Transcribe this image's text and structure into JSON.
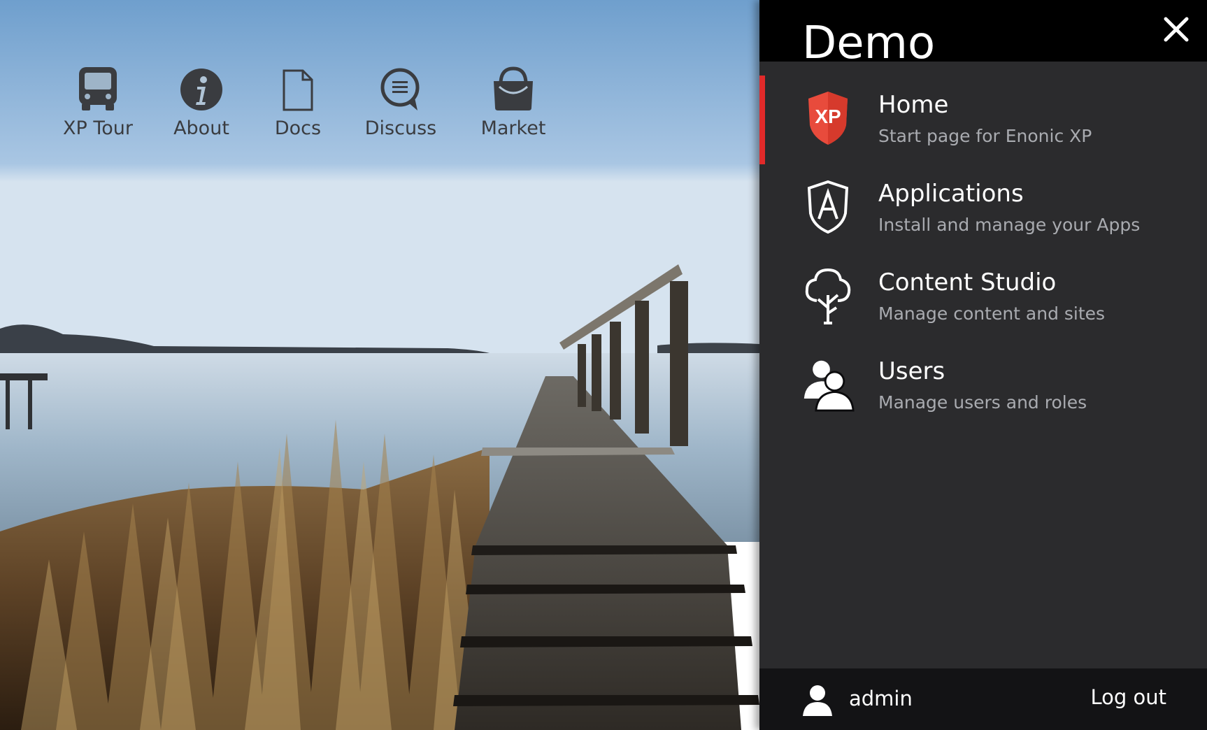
{
  "launcher": {
    "items": [
      {
        "label": "XP Tour",
        "icon": "bus-icon"
      },
      {
        "label": "About",
        "icon": "info-icon"
      },
      {
        "label": "Docs",
        "icon": "document-icon"
      },
      {
        "label": "Discuss",
        "icon": "chat-bubble-icon"
      },
      {
        "label": "Market",
        "icon": "shopping-bag-icon"
      }
    ]
  },
  "panel": {
    "title": "Demo",
    "close_icon": "close-icon",
    "apps": [
      {
        "name": "Home",
        "description": "Start page for Enonic XP",
        "icon": "xp-logo-icon",
        "active": true,
        "badge": "XP"
      },
      {
        "name": "Applications",
        "description": "Install and manage your Apps",
        "icon": "applications-shield-icon",
        "active": false
      },
      {
        "name": "Content Studio",
        "description": "Manage content and sites",
        "icon": "tree-icon",
        "active": false
      },
      {
        "name": "Users",
        "description": "Manage users and roles",
        "icon": "users-icon",
        "active": false
      }
    ],
    "footer": {
      "user_name": "admin",
      "logout_label": "Log out"
    }
  },
  "colors": {
    "accent": "#e12a2a",
    "panel_bg": "#0b0b0d",
    "text_dark": "#3a3c40",
    "desc_gray": "#a9abb0"
  }
}
